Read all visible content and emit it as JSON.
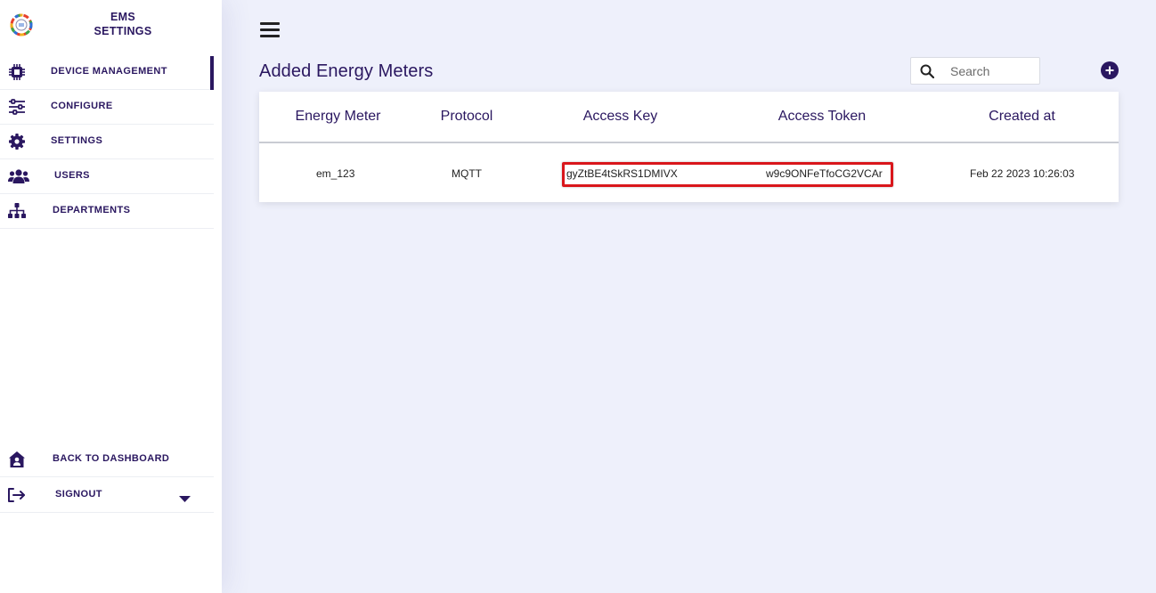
{
  "sidebar": {
    "brand_line1": "EMS",
    "brand_line2": "SETTINGS",
    "items": [
      {
        "label": "DEVICE MANAGEMENT",
        "icon": "chip-icon",
        "active": true
      },
      {
        "label": "CONFIGURE",
        "icon": "sliders-icon"
      },
      {
        "label": "SETTINGS",
        "icon": "gear-icon"
      },
      {
        "label": "USERS",
        "icon": "users-icon"
      },
      {
        "label": "DEPARTMENTS",
        "icon": "sitemap-icon"
      }
    ],
    "bottom_items": [
      {
        "label": "BACK TO DASHBOARD",
        "icon": "house-user-icon"
      },
      {
        "label": "SIGNOUT",
        "icon": "sign-out-icon"
      }
    ]
  },
  "header": {
    "title": "Added Energy Meters",
    "search_placeholder": "Search"
  },
  "table": {
    "columns": [
      "Energy Meter",
      "Protocol",
      "Access Key",
      "Access Token",
      "Created at"
    ],
    "rows": [
      [
        "em_123",
        "MQTT",
        "gyZtBE4tSkRS1DMIVX",
        "w9c9ONFeTfoCG2VCAr",
        "Feb 22 2023 10:26:03"
      ]
    ]
  },
  "colors": {
    "accent": "#2a1760",
    "background": "#eef0fb",
    "highlight_border": "#d9161b"
  }
}
